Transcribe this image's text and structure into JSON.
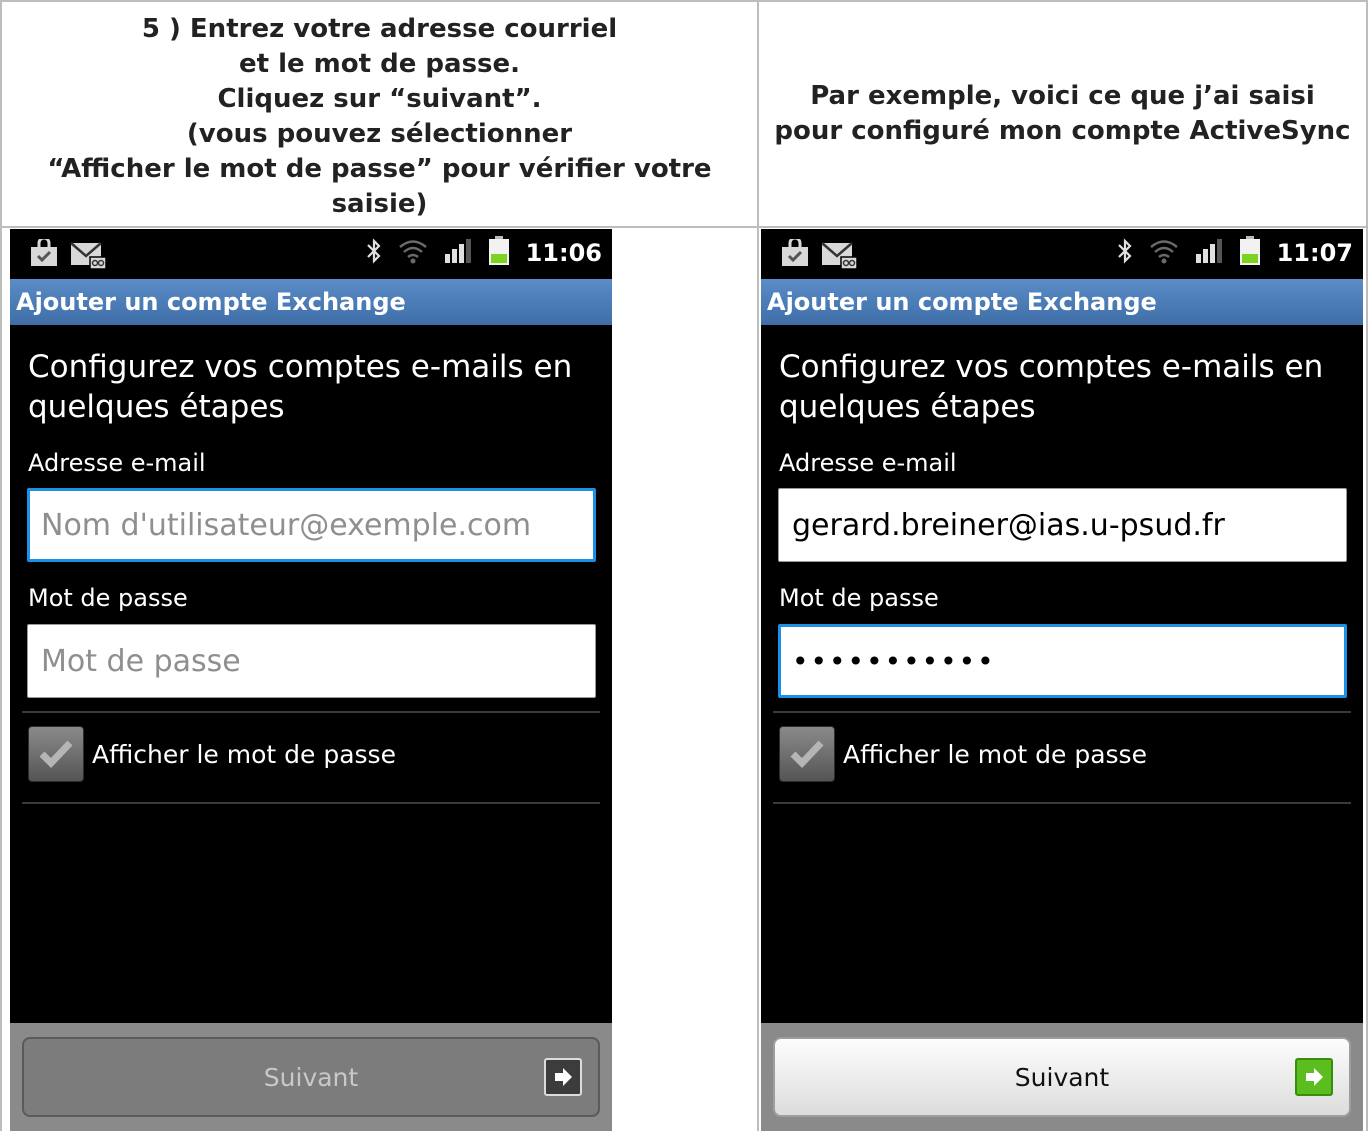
{
  "headings": {
    "left_lines": [
      "5 ) Entrez votre adresse courriel",
      "et le mot de passe.",
      "Cliquez sur “suivant”.",
      "(vous pouvez sélectionner",
      "“Afficher le mot de passe” pour vérifier votre",
      "saisie)"
    ],
    "right_lines": [
      "Par exemple, voici ce que j’ai saisi",
      "pour configuré mon compte ActiveSync"
    ]
  },
  "phones": [
    {
      "clock": "11:06",
      "title": "Ajouter un compte Exchange",
      "intro": "Configurez vos comptes e-mails en quelques étapes",
      "email_label": "Adresse e-mail",
      "email_value": "",
      "email_placeholder": "Nom d'utilisateur@exemple.com",
      "password_label": "Mot de passe",
      "password_value": "",
      "password_placeholder": "Mot de passe",
      "show_password_label": "Afficher le mot de passe",
      "next_label": "Suivant",
      "next_enabled": false
    },
    {
      "clock": "11:07",
      "title": "Ajouter un compte Exchange",
      "intro": "Configurez vos comptes e-mails en quelques étapes",
      "email_label": "Adresse e-mail",
      "email_value": "gerard.breiner@ias.u-psud.fr",
      "email_placeholder": "",
      "password_label": "Mot de passe",
      "password_value": "•••••••••••",
      "password_placeholder": "",
      "show_password_label": "Afficher le mot de passe",
      "next_label": "Suivant",
      "next_enabled": true
    }
  ],
  "icons": [
    "shopping-bag-icon",
    "mail-icon",
    "bluetooth-icon",
    "wifi-icon",
    "signal-icon",
    "battery-icon",
    "checkmark-icon",
    "arrow-right-icon"
  ],
  "colors": {
    "title_bar": "#4a7bb7",
    "focus_border": "#1c8fe6",
    "battery": "#7cd321",
    "next_arrow": "#5cbd1f"
  }
}
